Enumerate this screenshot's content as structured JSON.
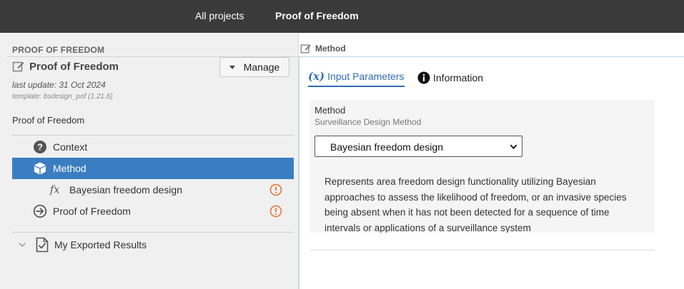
{
  "topbar": {
    "all_projects": "All projects",
    "current_project": "Proof of Freedom"
  },
  "left_pane": {
    "header": "PROOF OF FREEDOM",
    "project_title": "Proof of Freedom",
    "manage_label": "Manage",
    "last_update": "last update: 31 Oct 2024",
    "template": "template: bsdesign_pof (1.21.6)",
    "description": "Proof of Freedom",
    "tree": {
      "context": "Context",
      "method": "Method",
      "bayesian": "Bayesian freedom design",
      "proof": "Proof of Freedom"
    },
    "exported": "My Exported Results"
  },
  "right_pane": {
    "header": "Method",
    "tabs": {
      "input_parameters": "Input Parameters",
      "input_parameters_icon": "(x)",
      "information": "Information"
    },
    "method_card": {
      "title": "Method",
      "subtitle": "Surveillance Design Method",
      "selected": "Bayesian freedom design",
      "description": "Represents area freedom design functionality utilizing Bayesian approaches to assess the likelihood of freedom, or an invasive species being absent when it has not been detected for a sequence of time intervals or applications of a surveillance system"
    }
  },
  "colors": {
    "topbar": "#3a3a3a",
    "selected": "#3a7ec1",
    "accent": "#2f6db5",
    "warning": "#e8743b"
  },
  "icons": {
    "edit": "edit-icon",
    "manage_caret": "caret-down-icon",
    "context": "question-circle-icon",
    "method": "cube-icon",
    "bayesian": "function-icon",
    "proof": "arrow-circle-right-icon",
    "warning": "warning-circle-icon",
    "exported_chevron": "chevron-down-icon",
    "exported_doc": "document-check-icon",
    "info": "info-circle-icon"
  }
}
